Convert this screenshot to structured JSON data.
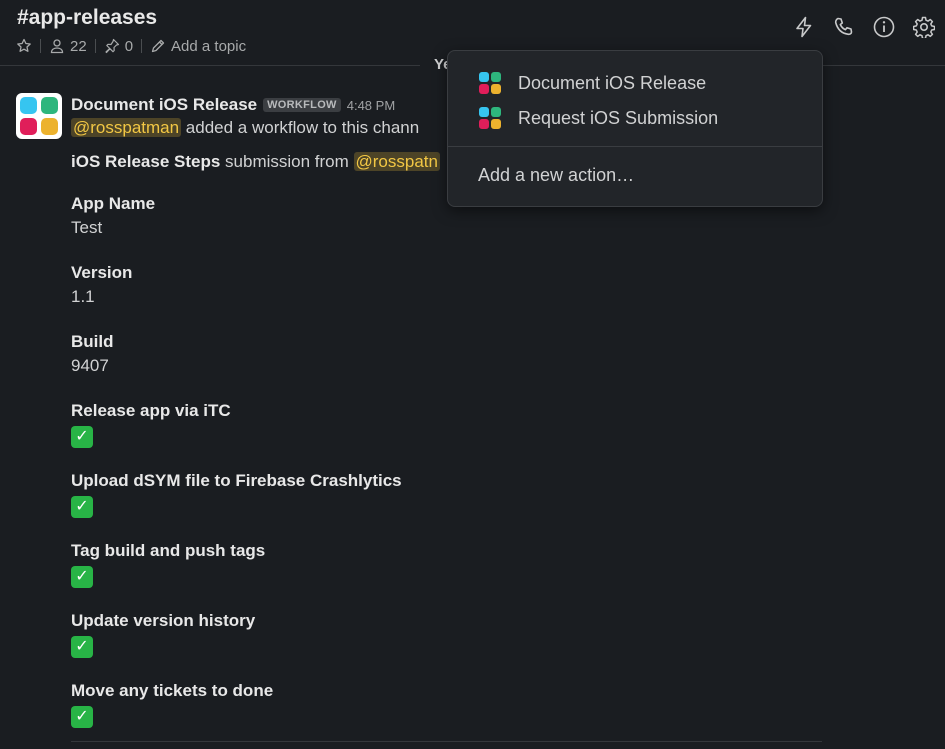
{
  "header": {
    "channel_name": "#app-releases",
    "member_count": "22",
    "pinned_count": "0",
    "add_topic": "Add a topic"
  },
  "divider": {
    "label": "Ye"
  },
  "message": {
    "sender": "Document iOS Release",
    "badge": "WORKFLOW",
    "time": "4:48 PM",
    "mention": "@rosspatman",
    "added_text": " added a workflow to this chann",
    "submission_prefix": "iOS Release Steps",
    "submission_text": " submission from ",
    "submission_mention": "@rosspatn",
    "fields": [
      {
        "label": "App Name",
        "value": "Test"
      },
      {
        "label": "Version",
        "value": "1.1"
      },
      {
        "label": "Build",
        "value": "9407"
      },
      {
        "label": "Release app via iTC",
        "value": "✓"
      },
      {
        "label": "Upload dSYM file to Firebase Crashlytics",
        "value": "✓"
      },
      {
        "label": "Tag build and push tags",
        "value": "✓"
      },
      {
        "label": "Update version history",
        "value": "✓"
      },
      {
        "label": "Move any tickets to done",
        "value": "✓"
      }
    ]
  },
  "popup": {
    "items": [
      {
        "label": "Document iOS Release"
      },
      {
        "label": "Request iOS Submission"
      }
    ],
    "add_action": "Add a new action…"
  },
  "colors": {
    "background": "#1a1d21",
    "mention_text": "#f2c744",
    "mention_bg": "#4d4427",
    "check_green": "#28b446",
    "logo_blue": "#36c5f0",
    "logo_green": "#2eb67d",
    "logo_red": "#e01e5a",
    "logo_yellow": "#ecb22e"
  },
  "icons": [
    "star-icon",
    "members-icon",
    "pin-icon",
    "pencil-icon",
    "lightning-icon",
    "phone-icon",
    "info-icon",
    "gear-icon",
    "workflow-logo-icon",
    "checkmark-icon"
  ]
}
